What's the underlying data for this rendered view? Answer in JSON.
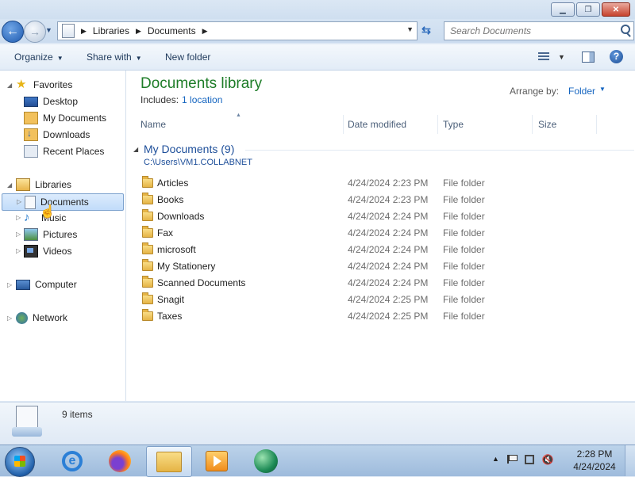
{
  "address": {
    "crumbs": [
      "Libraries",
      "Documents"
    ],
    "search_placeholder": "Search Documents"
  },
  "toolbar": {
    "organize": "Organize",
    "share_with": "Share with",
    "new_folder": "New folder"
  },
  "nav": {
    "favorites": "Favorites",
    "favorites_items": [
      "Desktop",
      "My Documents",
      "Downloads",
      "Recent Places"
    ],
    "libraries": "Libraries",
    "libraries_items": [
      "Documents",
      "Music",
      "Pictures",
      "Videos"
    ],
    "computer": "Computer",
    "network": "Network"
  },
  "library": {
    "title": "Documents library",
    "includes_label": "Includes:",
    "includes_link": "1 location",
    "arrange_label": "Arrange by:",
    "arrange_value": "Folder"
  },
  "columns": [
    "Name",
    "Date modified",
    "Type",
    "Size"
  ],
  "group": {
    "title": "My Documents (9)",
    "path": "C:\\Users\\VM1.COLLABNET"
  },
  "files": [
    {
      "name": "Articles",
      "date": "4/24/2024 2:23 PM",
      "type": "File folder"
    },
    {
      "name": "Books",
      "date": "4/24/2024 2:23 PM",
      "type": "File folder"
    },
    {
      "name": "Downloads",
      "date": "4/24/2024 2:24 PM",
      "type": "File folder"
    },
    {
      "name": "Fax",
      "date": "4/24/2024 2:24 PM",
      "type": "File folder"
    },
    {
      "name": "microsoft",
      "date": "4/24/2024 2:24 PM",
      "type": "File folder"
    },
    {
      "name": "My Stationery",
      "date": "4/24/2024 2:24 PM",
      "type": "File folder"
    },
    {
      "name": "Scanned Documents",
      "date": "4/24/2024 2:24 PM",
      "type": "File folder"
    },
    {
      "name": "Snagit",
      "date": "4/24/2024 2:25 PM",
      "type": "File folder"
    },
    {
      "name": "Taxes",
      "date": "4/24/2024 2:25 PM",
      "type": "File folder"
    }
  ],
  "details": {
    "count": "9 items"
  },
  "taskbar": {
    "time": "2:28 PM",
    "date": "4/24/2024"
  }
}
